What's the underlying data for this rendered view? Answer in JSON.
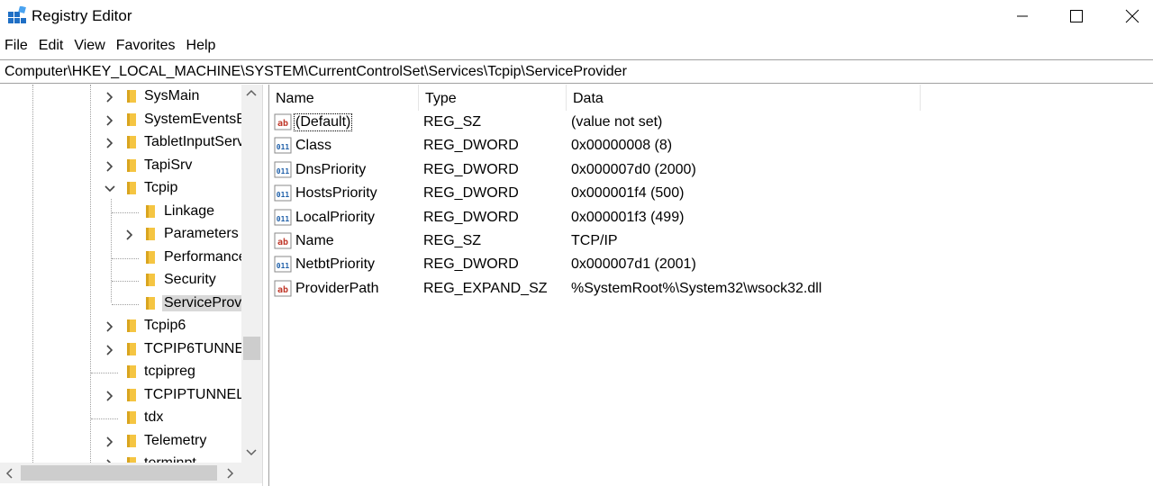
{
  "window": {
    "title": "Registry Editor"
  },
  "menu": [
    "File",
    "Edit",
    "View",
    "Favorites",
    "Help"
  ],
  "address": "Computer\\HKEY_LOCAL_MACHINE\\SYSTEM\\CurrentControlSet\\Services\\Tcpip\\ServiceProvider",
  "tree": {
    "items": [
      {
        "label": "SysMain",
        "level": 0,
        "chevron": "right"
      },
      {
        "label": "SystemEventsB",
        "level": 0,
        "chevron": "right"
      },
      {
        "label": "TabletInputServ",
        "level": 0,
        "chevron": "right"
      },
      {
        "label": "TapiSrv",
        "level": 0,
        "chevron": "right"
      },
      {
        "label": "Tcpip",
        "level": 0,
        "chevron": "down"
      },
      {
        "label": "Linkage",
        "level": 1,
        "chevron": "none"
      },
      {
        "label": "Parameters",
        "level": 1,
        "chevron": "right"
      },
      {
        "label": "Performance",
        "level": 1,
        "chevron": "none"
      },
      {
        "label": "Security",
        "level": 1,
        "chevron": "none"
      },
      {
        "label": "ServiceProvi",
        "level": 1,
        "chevron": "none",
        "selected": true
      },
      {
        "label": "Tcpip6",
        "level": 0,
        "chevron": "right"
      },
      {
        "label": "TCPIP6TUNNEL",
        "level": 0,
        "chevron": "right"
      },
      {
        "label": "tcpipreg",
        "level": 0,
        "chevron": "none"
      },
      {
        "label": "TCPIPTUNNEL",
        "level": 0,
        "chevron": "right"
      },
      {
        "label": "tdx",
        "level": 0,
        "chevron": "none"
      },
      {
        "label": "Telemetry",
        "level": 0,
        "chevron": "right"
      },
      {
        "label": "terminpt",
        "level": 0,
        "chevron": "right"
      }
    ]
  },
  "list": {
    "columns": [
      "Name",
      "Type",
      "Data"
    ],
    "rows": [
      {
        "icon": "string-value-icon",
        "name": "(Default)",
        "type": "REG_SZ",
        "data": "(value not set)",
        "focused": true
      },
      {
        "icon": "binary-value-icon",
        "name": "Class",
        "type": "REG_DWORD",
        "data": "0x00000008 (8)"
      },
      {
        "icon": "binary-value-icon",
        "name": "DnsPriority",
        "type": "REG_DWORD",
        "data": "0x000007d0 (2000)"
      },
      {
        "icon": "binary-value-icon",
        "name": "HostsPriority",
        "type": "REG_DWORD",
        "data": "0x000001f4 (500)"
      },
      {
        "icon": "binary-value-icon",
        "name": "LocalPriority",
        "type": "REG_DWORD",
        "data": "0x000001f3 (499)"
      },
      {
        "icon": "string-value-icon",
        "name": "Name",
        "type": "REG_SZ",
        "data": "TCP/IP"
      },
      {
        "icon": "binary-value-icon",
        "name": "NetbtPriority",
        "type": "REG_DWORD",
        "data": "0x000007d1 (2001)"
      },
      {
        "icon": "string-value-icon",
        "name": "ProviderPath",
        "type": "REG_EXPAND_SZ",
        "data": "%SystemRoot%\\System32\\wsock32.dll"
      }
    ]
  },
  "colors": {
    "folder": "#f5c542",
    "folder_dark": "#d9a520",
    "selection": "#d9d9d9",
    "string_icon": "#c0392b",
    "binary_icon": "#1f5fa8"
  }
}
